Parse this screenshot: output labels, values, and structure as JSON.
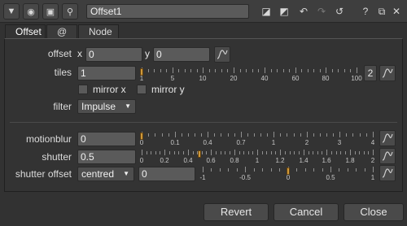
{
  "titlebar": {
    "node_name": "Offset1",
    "icons": [
      "collapse-icon",
      "target-icon",
      "viewer-icon",
      "pin-icon",
      "color-swatch-icon",
      "color-swatch-2-icon",
      "undo-icon",
      "redo-icon",
      "revert-icon",
      "help-icon",
      "float-icon",
      "close-icon"
    ],
    "help_label": "?"
  },
  "tabs": [
    {
      "label": "Offset"
    },
    {
      "label": "@"
    },
    {
      "label": "Node"
    }
  ],
  "offset": {
    "label": "offset",
    "x_label": "x",
    "x_value": "0",
    "y_label": "y",
    "y_value": "0"
  },
  "tiles": {
    "label": "tiles",
    "value": "1",
    "ticks": [
      "1",
      "5",
      "10",
      "20",
      "40",
      "60",
      "80",
      "100"
    ],
    "slider_value": 1,
    "count_button": "2"
  },
  "mirror": {
    "x_label": "mirror x",
    "y_label": "mirror y",
    "x_checked": false,
    "y_checked": false
  },
  "filter": {
    "label": "filter",
    "value": "Impulse"
  },
  "motionblur": {
    "label": "motionblur",
    "value": "0",
    "ticks": [
      "0",
      "0.1",
      "0.4",
      "0.7",
      "1",
      "2",
      "3",
      "4"
    ],
    "slider_value": 0
  },
  "shutter": {
    "label": "shutter",
    "value": "0.5",
    "ticks": [
      "0",
      "0.2",
      "0.4",
      "0.6",
      "0.8",
      "1",
      "1.2",
      "1.4",
      "1.6",
      "1.8",
      "2"
    ],
    "slider_value": 0.5
  },
  "shutter_offset": {
    "label": "shutter offset",
    "mode": "centred",
    "value": "0",
    "ticks": [
      "-1",
      "-0.5",
      "0",
      "0.5",
      "1"
    ],
    "slider_value": 0
  },
  "buttons": {
    "revert": "Revert",
    "cancel": "Cancel",
    "close": "Close"
  }
}
